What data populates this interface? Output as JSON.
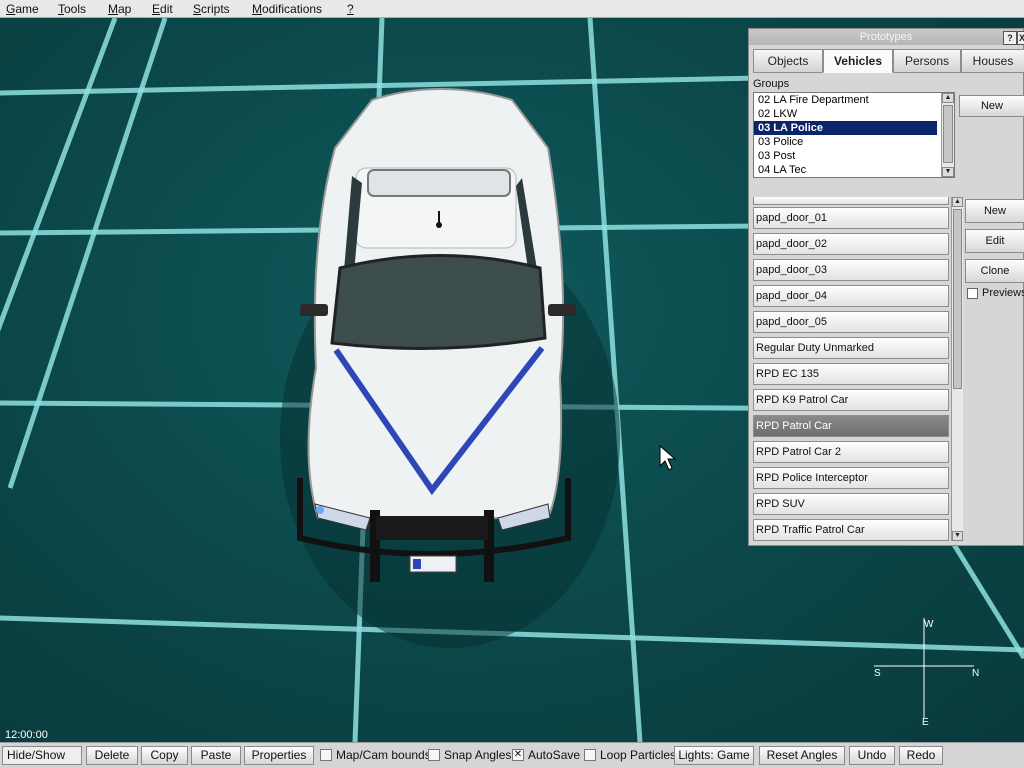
{
  "menu": [
    {
      "label": "Game",
      "u": "G",
      "rest": "ame"
    },
    {
      "label": "Tools",
      "u": "T",
      "rest": "ools"
    },
    {
      "label": "Map",
      "u": "M",
      "rest": "ap"
    },
    {
      "label": "Edit",
      "u": "E",
      "rest": "dit"
    },
    {
      "label": "Scripts",
      "u": "S",
      "rest": "cripts"
    },
    {
      "label": "Modifications",
      "u": "M",
      "rest": "odifications"
    },
    {
      "label": "?",
      "u": "?",
      "rest": ""
    }
  ],
  "panel": {
    "title": "Prototypes",
    "help_btn": "?",
    "close_btn": "X",
    "tabs": [
      "Objects",
      "Vehicles",
      "Persons",
      "Houses"
    ],
    "active_tab": "Vehicles",
    "groups_label": "Groups",
    "groups": [
      "02 LA Fire Department",
      "02 LKW",
      "03 LA Police",
      "03 Police",
      "03 Post",
      "04 LA Tec"
    ],
    "selected_group": "03 LA Police",
    "group_new": "New",
    "items": [
      "papd_door_01",
      "papd_door_02",
      "papd_door_03",
      "papd_door_04",
      "papd_door_05",
      "Regular Duty Unmarked",
      "RPD EC 135",
      "RPD K9 Patrol Car",
      "RPD Patrol Car",
      "RPD Patrol Car 2",
      "RPD Police Interceptor",
      "RPD SUV",
      "RPD Traffic Patrol Car"
    ],
    "selected_item": "RPD Patrol Car",
    "buttons": {
      "new": "New",
      "edit": "Edit",
      "clone": "Clone"
    },
    "previews_label": "Previews",
    "previews_checked": false
  },
  "compass": {
    "n": "N",
    "s": "S",
    "e": "E",
    "w": "W"
  },
  "clock": "12:00:00",
  "bottom": {
    "hide_show": "Hide/Show",
    "delete": "Delete",
    "copy": "Copy",
    "paste": "Paste",
    "properties": "Properties",
    "map_cam_bounds": "Map/Cam bounds",
    "snap_angles": "Snap Angles",
    "autosave": "AutoSave",
    "loop_particles": "Loop Particles",
    "lights": "Lights: Game",
    "reset_angles": "Reset Angles",
    "undo": "Undo",
    "redo": "Redo",
    "map_cam_checked": false,
    "snap_checked": false,
    "autosave_checked": true,
    "loop_checked": false
  },
  "colors": {
    "selection": "#0a246a",
    "grid": "#7fd3d3",
    "viewport": "#0c4a4c"
  }
}
